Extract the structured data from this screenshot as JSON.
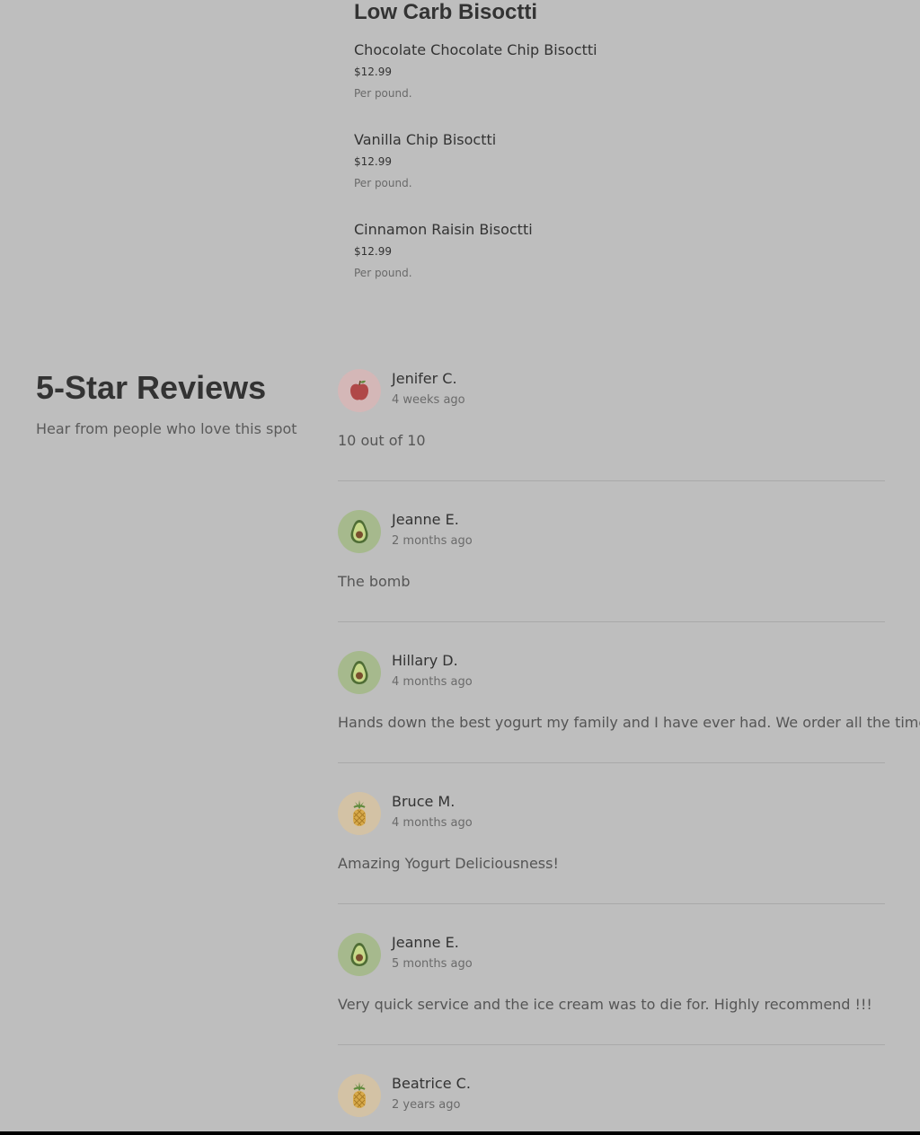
{
  "menu": {
    "section_title": "Low Carb Bisoctti",
    "items": [
      {
        "name": "Chocolate Chocolate Chip Bisoctti",
        "price": "$12.99",
        "description": "Per pound."
      },
      {
        "name": "Vanilla Chip Bisoctti",
        "price": "$12.99",
        "description": "Per pound."
      },
      {
        "name": "Cinnamon Raisin Bisoctti",
        "price": "$12.99",
        "description": "Per pound."
      }
    ]
  },
  "reviews": {
    "title": "5-Star Reviews",
    "subtitle": "Hear from people who love this spot",
    "items": [
      {
        "name": "Jenifer C.",
        "time": "4 weeks ago",
        "text": "10 out of 10",
        "avatar_icon": "apple-icon",
        "avatar_bg": "#d4b7b7"
      },
      {
        "name": "Jeanne E.",
        "time": "2 months ago",
        "text": "The bomb",
        "avatar_icon": "avocado-icon",
        "avatar_bg": "#a6b98d"
      },
      {
        "name": "Hillary D.",
        "time": "4 months ago",
        "text": "Hands down the best yogurt my family and I have ever had. We order all the time!",
        "avatar_icon": "avocado-icon",
        "avatar_bg": "#a6b98d"
      },
      {
        "name": "Bruce M.",
        "time": "4 months ago",
        "text": "Amazing Yogurt Deliciousness!",
        "avatar_icon": "pineapple-icon",
        "avatar_bg": "#d3c2a5"
      },
      {
        "name": "Jeanne E.",
        "time": "5 months ago",
        "text": "Very quick service and the ice cream was to die for. Highly recommend !!!",
        "avatar_icon": "avocado-icon",
        "avatar_bg": "#a6b98d"
      },
      {
        "name": "Beatrice C.",
        "time": "2 years ago",
        "text": "",
        "avatar_icon": "pineapple-icon",
        "avatar_bg": "#d3c2a5"
      }
    ]
  }
}
